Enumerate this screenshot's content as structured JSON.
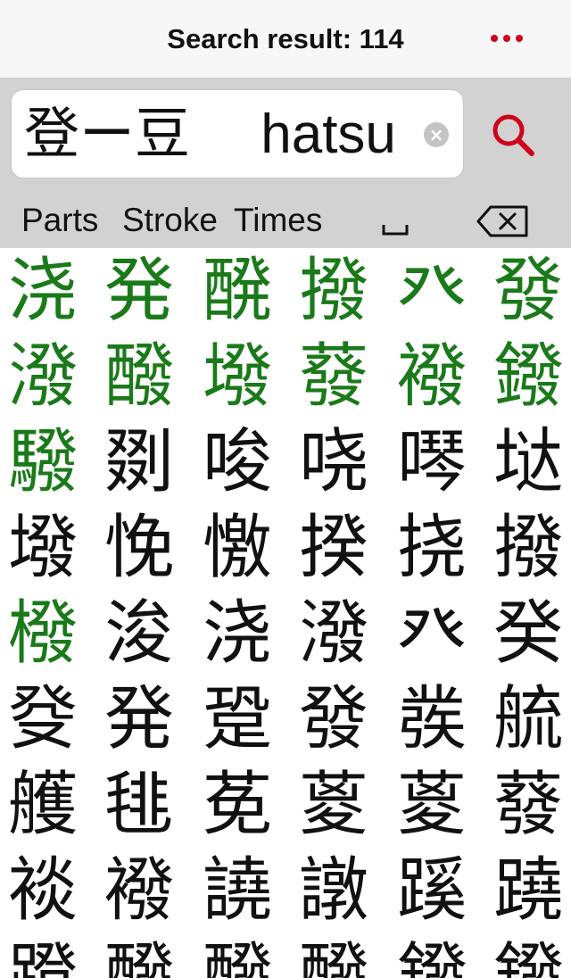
{
  "header": {
    "title": "Search result: 114"
  },
  "search": {
    "query": "登ー豆　 hatsu"
  },
  "toolbar": {
    "parts_label": "Parts",
    "stroke_label": "Stroke",
    "times_label": "Times"
  },
  "colors": {
    "accent": "#d0021b",
    "highlight_kanji": "#1a7a1a",
    "regular_kanji": "#111111",
    "panel_bg": "#d2d2d2"
  },
  "results": [
    {
      "char": "浇",
      "highlight": true
    },
    {
      "char": "発",
      "highlight": true
    },
    {
      "char": "醗",
      "highlight": true
    },
    {
      "char": "撥",
      "highlight": true
    },
    {
      "char": "癶",
      "highlight": true
    },
    {
      "char": "發",
      "highlight": true
    },
    {
      "char": "潑",
      "highlight": true
    },
    {
      "char": "醱",
      "highlight": true
    },
    {
      "char": "墢",
      "highlight": true
    },
    {
      "char": "蕟",
      "highlight": true
    },
    {
      "char": "襏",
      "highlight": true
    },
    {
      "char": "鏺",
      "highlight": true
    },
    {
      "char": "驋",
      "highlight": true
    },
    {
      "char": "剟",
      "highlight": false
    },
    {
      "char": "唆",
      "highlight": false
    },
    {
      "char": "哓",
      "highlight": false
    },
    {
      "char": "噖",
      "highlight": false
    },
    {
      "char": "垯",
      "highlight": false
    },
    {
      "char": "墢",
      "highlight": false
    },
    {
      "char": "悗",
      "highlight": false
    },
    {
      "char": "憿",
      "highlight": false
    },
    {
      "char": "揆",
      "highlight": false
    },
    {
      "char": "挠",
      "highlight": false
    },
    {
      "char": "撥",
      "highlight": false
    },
    {
      "char": "橃",
      "highlight": true
    },
    {
      "char": "浚",
      "highlight": false
    },
    {
      "char": "浇",
      "highlight": false
    },
    {
      "char": "潑",
      "highlight": false
    },
    {
      "char": "癶",
      "highlight": false
    },
    {
      "char": "癸",
      "highlight": false
    },
    {
      "char": "癹",
      "highlight": false
    },
    {
      "char": "発",
      "highlight": false
    },
    {
      "char": "跫",
      "highlight": false
    },
    {
      "char": "發",
      "highlight": false
    },
    {
      "char": "彂",
      "highlight": false
    },
    {
      "char": "艈",
      "highlight": false
    },
    {
      "char": "艧",
      "highlight": false
    },
    {
      "char": "毴",
      "highlight": false
    },
    {
      "char": "莬",
      "highlight": false
    },
    {
      "char": "葼",
      "highlight": false
    },
    {
      "char": "葼",
      "highlight": false
    },
    {
      "char": "蕟",
      "highlight": false
    },
    {
      "char": "裧",
      "highlight": false
    },
    {
      "char": "襏",
      "highlight": false
    },
    {
      "char": "譊",
      "highlight": false
    },
    {
      "char": "譈",
      "highlight": false
    },
    {
      "char": "蹊",
      "highlight": false
    },
    {
      "char": "蹺",
      "highlight": false
    },
    {
      "char": "蹬",
      "highlight": false
    },
    {
      "char": "醱",
      "highlight": false
    },
    {
      "char": "醱",
      "highlight": false
    },
    {
      "char": "醱",
      "highlight": false
    },
    {
      "char": "鏺",
      "highlight": false
    },
    {
      "char": "鏺",
      "highlight": false
    }
  ]
}
